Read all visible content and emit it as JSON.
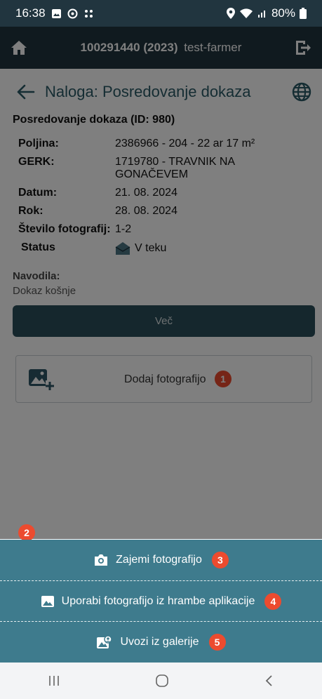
{
  "status_bar": {
    "time": "16:38",
    "battery": "80%"
  },
  "header": {
    "id_text": "100291440 (2023)",
    "user": "test-farmer"
  },
  "page": {
    "title": "Naloga: Posredovanje dokaza"
  },
  "task": {
    "heading": "Posredovanje dokaza (ID: 980)",
    "fields": [
      {
        "label": "Poljina:",
        "value": "2386966 - 204 - 22 ar 17 m²"
      },
      {
        "label": "GERK:",
        "value": "1719780 - TRAVNIK NA GONAČEVEM"
      },
      {
        "label": "Datum:",
        "value": "21. 08. 2024"
      },
      {
        "label": "Rok:",
        "value": "28. 08. 2024"
      },
      {
        "label": "Število fotografij:",
        "value": "1-2"
      },
      {
        "label": "Status",
        "value": "V teku"
      }
    ],
    "instructions_label": "Navodila:",
    "instructions_text": "Dokaz košnje",
    "more_button": "Več"
  },
  "add_photo": {
    "label": "Dodaj fotografijo",
    "badge": "1"
  },
  "menu_badge": "2",
  "sheet": {
    "items": [
      {
        "label": "Zajemi fotografijo",
        "badge": "3",
        "icon": "camera-icon"
      },
      {
        "label": "Uporabi fotografijo iz hrambe aplikacije",
        "badge": "4",
        "icon": "image-icon"
      },
      {
        "label": "Uvozi iz galerije",
        "badge": "5",
        "icon": "gallery-import-icon"
      }
    ]
  },
  "colors": {
    "appbar": "#21353f",
    "sheet": "#3e7b8d",
    "badge": "#ec4b2f",
    "accent": "#2a5a66"
  }
}
